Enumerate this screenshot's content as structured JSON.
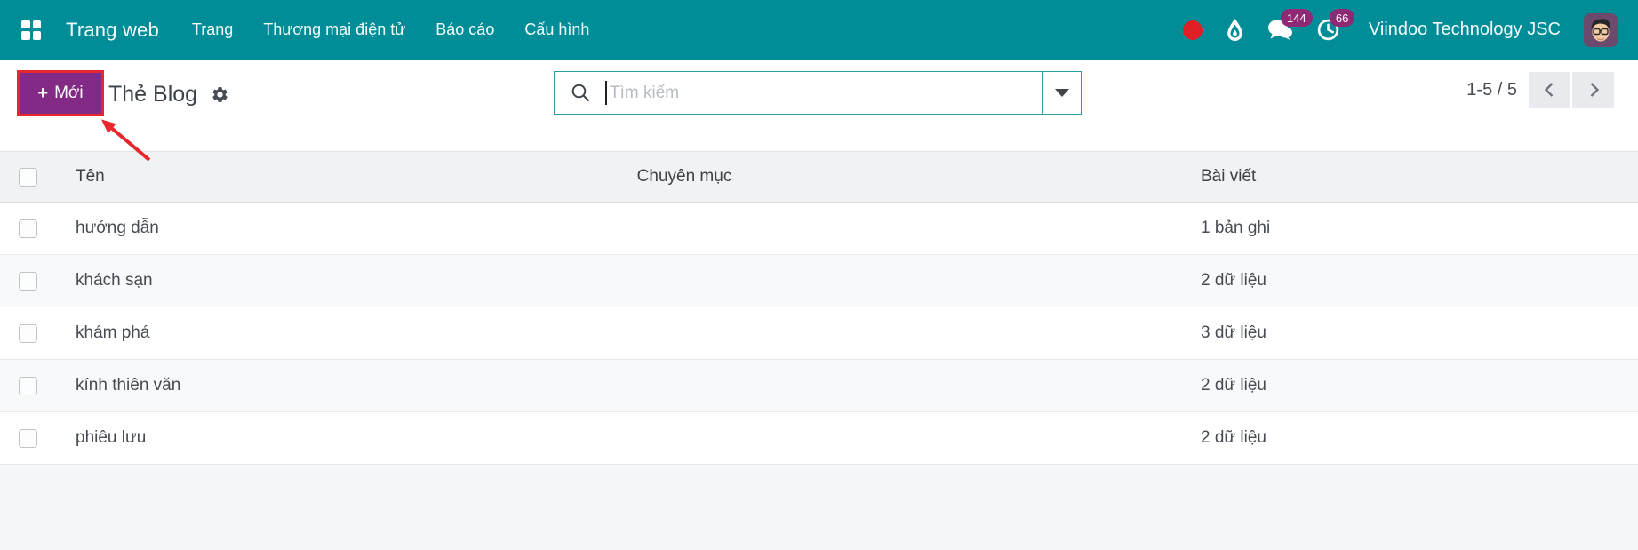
{
  "topbar": {
    "brand": "Trang web",
    "menus": [
      "Trang",
      "Thương mại điện tử",
      "Báo cáo",
      "Cấu hình"
    ],
    "badges": {
      "messages": "144",
      "activities": "66"
    },
    "company": "Viindoo Technology JSC"
  },
  "controls": {
    "new_button_plus": "+",
    "new_button": "Mới",
    "title": "Thẻ Blog",
    "search_placeholder": "Tìm kiếm",
    "pager": "1-5 / 5"
  },
  "table": {
    "headers": {
      "name": "Tên",
      "category": "Chuyên mục",
      "posts": "Bài viết"
    },
    "rows": [
      {
        "name": "hướng dẫn",
        "category": "",
        "posts": "1 bản ghi"
      },
      {
        "name": "khách sạn",
        "category": "",
        "posts": "2 dữ liệu"
      },
      {
        "name": "khám phá",
        "category": "",
        "posts": "3 dữ liệu"
      },
      {
        "name": "kính thiên văn",
        "category": "",
        "posts": "2 dữ liệu"
      },
      {
        "name": "phiêu lưu",
        "category": "",
        "posts": "2 dữ liệu"
      }
    ]
  },
  "icons": {
    "apps": "grid-2x2",
    "record_indicator": "red-dot",
    "livechat": "droplet",
    "messages": "chat-bubbles",
    "activities": "clock",
    "search": "magnifier",
    "search_options": "caret-down",
    "settings": "gear",
    "pager_prev": "chevron-left",
    "pager_next": "chevron-right"
  },
  "colors": {
    "topbar_teal": "#008d97",
    "button_purple": "#832a86",
    "badge_purple": "#8f2976",
    "annotation_red": "#e8272c",
    "search_border_teal": "#2d9da7",
    "red_dot": "#e01e26"
  }
}
